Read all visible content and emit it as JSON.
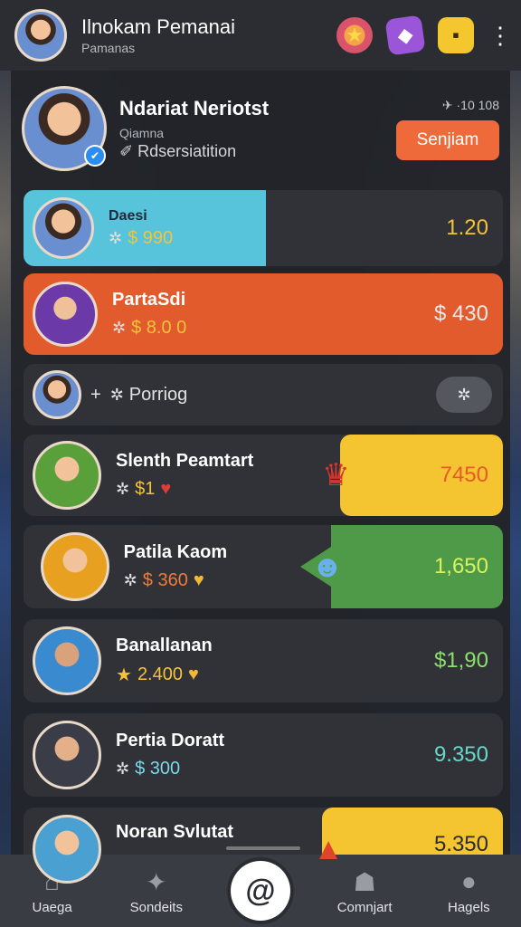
{
  "header": {
    "title": "Ilnokam Pemanai",
    "subtitle": "Pamanas",
    "icons": [
      "candy-icon",
      "dice-icon",
      "cube-icon"
    ]
  },
  "profile": {
    "name": "Ndariat Neriotst",
    "role": "Qiamna",
    "status": "Rdsersiatition",
    "meta": "✈ ·10 108",
    "join_label": "Senjiam"
  },
  "rows": [
    {
      "name": "Daesi",
      "sub": "990",
      "value": "1.20",
      "value_color": "#f5c23a"
    },
    {
      "name": "PartaSdi",
      "sub": "8.0 0",
      "value": "$ 430",
      "value_color": "#e9e9e9"
    },
    {
      "name": "Porriog"
    },
    {
      "name": "Slenth Peamtart",
      "sub": "1",
      "value": "7450",
      "value_color": "#e85a2a"
    },
    {
      "name": "Patila Kaom",
      "sub": "360",
      "value": "1,650",
      "value_color": "#d9f25a"
    },
    {
      "name": "Banallanan",
      "sub": "2.400",
      "value": "$1,90",
      "value_color": "#8ce06a"
    },
    {
      "name": "Pertia Doratt",
      "sub": "300",
      "value": "9.350",
      "value_color": "#67d8c8"
    },
    {
      "name": "Noran Svlutat",
      "value": "5.350",
      "value_color": "#2a2c32"
    }
  ],
  "nav": [
    {
      "label": "Uaega",
      "icon": "home-icon"
    },
    {
      "label": "Sondeits",
      "icon": "bird-icon"
    },
    {
      "label": "",
      "icon": "swirl-icon"
    },
    {
      "label": "Comnjart",
      "icon": "character-icon"
    },
    {
      "label": "Hagels",
      "icon": "profile-icon"
    }
  ]
}
